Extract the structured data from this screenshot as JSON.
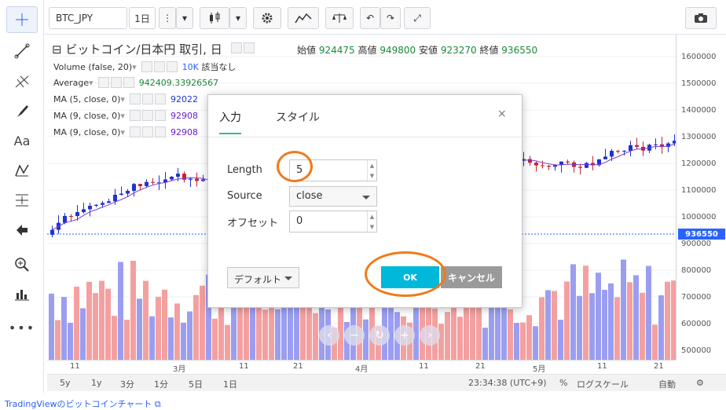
{
  "toolbar": {
    "symbol": "BTC_JPY",
    "interval": "1日"
  },
  "legend": {
    "title": "ビットコイン/日本円 取引, 日",
    "ohlc": [
      {
        "k": "始値",
        "v": "924475"
      },
      {
        "k": "高値",
        "v": "949800"
      },
      {
        "k": "安値",
        "v": "923270"
      },
      {
        "k": "終値",
        "v": "936550"
      }
    ],
    "indicators": [
      {
        "label": "Volume (false, 20)",
        "value": "10K",
        "extra": "該当なし",
        "color": "#2962ff"
      },
      {
        "label": "Average",
        "value": "942409.33926567",
        "extra": "",
        "color": "#1b8a3b"
      },
      {
        "label": "MA (5, close, 0)",
        "value": "92022",
        "extra": "",
        "color": "#2233cc"
      },
      {
        "label": "MA (9, close, 0)",
        "value": "92908",
        "extra": "",
        "color": "#6a1bcc"
      },
      {
        "label": "MA (9, close, 0)",
        "value": "92908",
        "extra": "",
        "color": "#6a1bcc"
      }
    ]
  },
  "price_axis": {
    "labels": [
      "1600000",
      "1500000",
      "1400000",
      "1300000",
      "1200000",
      "1100000",
      "1000000",
      "900000",
      "800000",
      "700000",
      "600000",
      "500000"
    ],
    "current": "936550",
    "current_color": "#2962ff"
  },
  "time_axis": {
    "labels": [
      "11",
      "3月",
      "11",
      "21",
      "4月",
      "11",
      "21",
      "5月",
      "11",
      "21"
    ]
  },
  "bottom": {
    "ranges": [
      "5y",
      "1y",
      "3分",
      "1分",
      "5日",
      "1日"
    ],
    "time": "23:34:38 (UTC+9)",
    "percent": "%",
    "log": "ログスケール",
    "auto": "自動"
  },
  "footer": {
    "link": "TradingViewのビットコインチャート"
  },
  "dialog": {
    "tabs": [
      "入力",
      "スタイル"
    ],
    "close": "×",
    "fields": {
      "length_label": "Length",
      "length_value": "5",
      "source_label": "Source",
      "source_value": "close",
      "offset_label": "オフセット",
      "offset_value": "0"
    },
    "default_button": "デフォルト",
    "ok": "OK",
    "cancel": "キャンセル"
  },
  "colors": {
    "up": "#2233cc",
    "down": "#c8202c",
    "vol_up": "#9b9ef0",
    "vol_down": "#f4a0a0",
    "ma": "#7a3ed6",
    "highlight": "#f07a1a",
    "ok": "#00b8d9"
  }
}
